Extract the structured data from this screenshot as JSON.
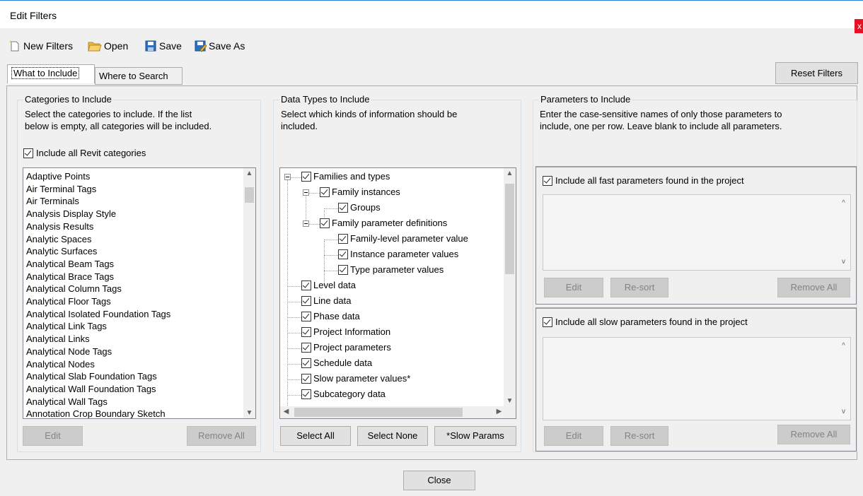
{
  "window": {
    "title": "Edit Filters",
    "close_glyph": "x"
  },
  "toolbar": {
    "new_filters": "New Filters",
    "open": "Open",
    "save": "Save",
    "save_as": "Save As"
  },
  "tabs": {
    "what_to_include": "What to Include",
    "where_to_search": "Where to Search"
  },
  "reset_filters": "Reset Filters",
  "categories": {
    "title": "Categories to Include",
    "desc_line1": "Select the categories to include.  If the list",
    "desc_line2": "below is empty, all categories will be included.",
    "include_all_label": "Include all Revit categories",
    "include_all_checked": true,
    "items": [
      "Adaptive Points",
      "Air Terminal Tags",
      "Air Terminals",
      "Analysis Display Style",
      "Analysis Results",
      "Analytic Spaces",
      "Analytic Surfaces",
      "Analytical Beam Tags",
      "Analytical Brace Tags",
      "Analytical Column Tags",
      "Analytical Floor Tags",
      "Analytical Isolated Foundation Tags",
      "Analytical Link Tags",
      "Analytical Links",
      "Analytical Node Tags",
      "Analytical Nodes",
      "Analytical Slab Foundation Tags",
      "Analytical Wall Foundation Tags",
      "Analytical Wall Tags",
      "Annotation Crop Boundary Sketch"
    ],
    "edit": "Edit",
    "remove_all": "Remove All"
  },
  "data_types": {
    "title": "Data Types to Include",
    "desc_line1": "Select which kinds of information should be",
    "desc_line2": "included.",
    "nodes": [
      "Families and types",
      "Family instances",
      "Groups",
      "Family parameter definitions",
      "Family-level parameter value",
      "Instance parameter values",
      "Type parameter values",
      "Level data",
      "Line data",
      "Phase data",
      "Project Information",
      "Project parameters",
      "Schedule data",
      "Slow parameter values*",
      "Subcategory data"
    ],
    "select_all": "Select All",
    "select_none": "Select None",
    "slow_params": "*Slow Params"
  },
  "parameters": {
    "title": "Parameters to Include",
    "desc_line1": "Enter the case-sensitive names of only those parameters to",
    "desc_line2": "include, one per row.  Leave blank to include all parameters.",
    "fast_label": "Include all fast parameters found in the project",
    "slow_label": "Include all slow parameters found in the project",
    "edit": "Edit",
    "resort": "Re-sort",
    "remove_all": "Remove All"
  },
  "close": "Close"
}
